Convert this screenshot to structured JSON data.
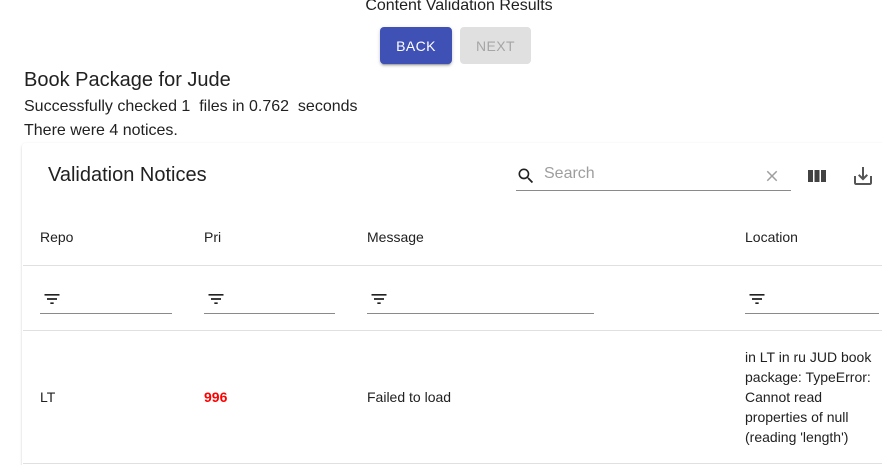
{
  "page": {
    "title": "Content Validation Results"
  },
  "nav": {
    "back_label": "BACK",
    "next_label": "NEXT"
  },
  "package": {
    "title": "Book Package for Jude",
    "checked_line": "Successfully checked 1  files in 0.762  seconds",
    "notices_line": "There were 4 notices."
  },
  "table": {
    "title": "Validation Notices",
    "search_placeholder": "Search",
    "icons": {
      "search": "search-icon",
      "clear": "close-icon",
      "columns": "view-columns-icon",
      "download": "download-icon",
      "filter": "filter-list-icon"
    },
    "columns": [
      "Repo",
      "Pri",
      "Message",
      "Location"
    ],
    "rows": [
      {
        "repo": "LT",
        "pri": "996",
        "message": "Failed to load",
        "location": "in LT in ru JUD book package: TypeError: Cannot read properties of null (reading 'length')"
      }
    ]
  },
  "colors": {
    "primary": "#3f51b5",
    "priority": "#ff0000",
    "disabled_bg": "#e0e0e0"
  }
}
